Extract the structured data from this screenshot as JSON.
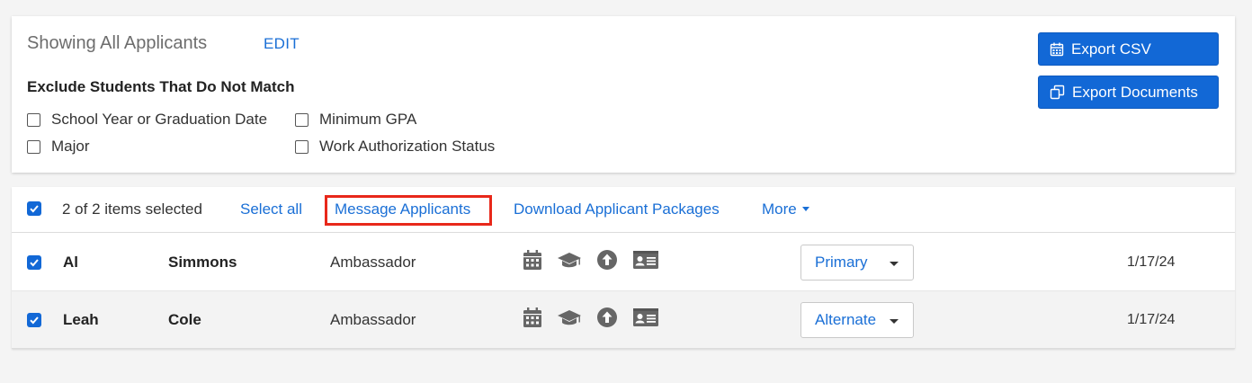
{
  "filter": {
    "title": "Showing All Applicants",
    "edit_label": "EDIT",
    "exclude_heading": "Exclude Students That Do Not Match",
    "options": [
      {
        "label": "School Year or Graduation Date",
        "checked": false
      },
      {
        "label": "Minimum GPA",
        "checked": false
      },
      {
        "label": "Major",
        "checked": false
      },
      {
        "label": "Work Authorization Status",
        "checked": false
      }
    ]
  },
  "actions": {
    "export_csv": "Export CSV",
    "export_documents": "Export Documents"
  },
  "bulk": {
    "selected_text": "2 of 2 items selected",
    "select_all": "Select all",
    "message_applicants": "Message Applicants",
    "download_packages": "Download Applicant Packages",
    "more": "More"
  },
  "applicants": [
    {
      "first": "Al",
      "last": "Simmons",
      "role": "Ambassador",
      "status": "Primary",
      "date": "1/17/24",
      "selected": true
    },
    {
      "first": "Leah",
      "last": "Cole",
      "role": "Ambassador",
      "status": "Alternate",
      "date": "1/17/24",
      "selected": true
    }
  ],
  "colors": {
    "accent": "#1268d6",
    "link": "#1a6fd6",
    "highlight": "#e8281a"
  },
  "icons": [
    "calendar-icon",
    "graduation-cap-icon",
    "upload-circle-icon",
    "id-card-icon"
  ]
}
